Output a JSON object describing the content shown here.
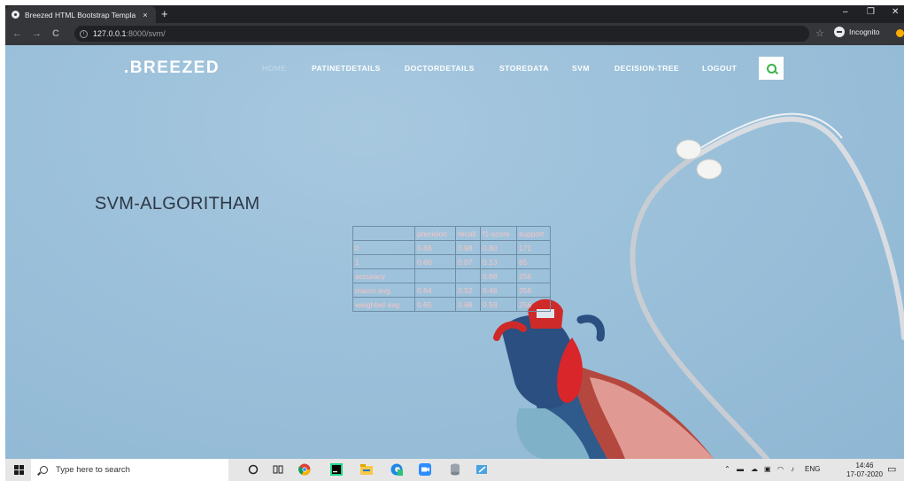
{
  "browser": {
    "tab_title": "Breezed HTML Bootstrap Templa",
    "tab_close": "×",
    "new_tab": "+",
    "url_host": "127.0.0.1",
    "url_path": ":8000/svm/",
    "incognito_label": "Incognito",
    "min": "–",
    "restore": "❐",
    "close": "✕",
    "back": "←",
    "forward": "→",
    "reload": "C",
    "star": "☆"
  },
  "site": {
    "brand": ".BREEZED",
    "menu": [
      "HOME",
      "PATINETDETAILS",
      "DOCTORDETAILS",
      "STOREDATA",
      "SVM",
      "DECISION-TREE",
      "LOGOUT"
    ],
    "heading": "SVM-ALGORITHAM"
  },
  "report": {
    "header": [
      "",
      "precision",
      "recall",
      "f1-score",
      "support"
    ],
    "rows": [
      [
        "0",
        "0.68",
        "0.98",
        "0.80",
        "171"
      ],
      [
        "1",
        "0.60",
        "0.07",
        "0.13",
        "85"
      ],
      [
        "accuracy",
        "",
        "",
        "0.68",
        "256"
      ],
      [
        "macro avg",
        "0.64",
        "0.52",
        "0.46",
        "256"
      ],
      [
        "weighted avg",
        "0.65",
        "0.68",
        "0.58",
        "256"
      ]
    ]
  },
  "taskbar": {
    "search_placeholder": "Type here to search",
    "lang": "ENG",
    "time": "14:46",
    "date": "17-07-2020"
  },
  "colors": {
    "chrome_dark": "#202124",
    "page_bg": "#9bc0da",
    "accent_green": "#3bb34a",
    "table_text": "#f7c4c4"
  }
}
